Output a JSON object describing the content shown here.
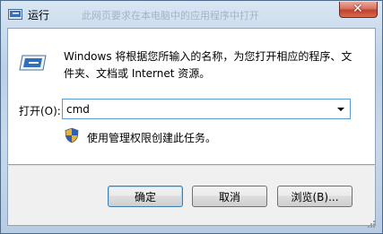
{
  "window": {
    "title": "运行",
    "background_ghost_text": "此网页要求在本电脑中的应用程序中打开",
    "close_glyph": "✕"
  },
  "dialog": {
    "description": "Windows 将根据您所输入的名称，为您打开相应的程序、文件夹、文档或 Internet 资源。",
    "open_label": "打开(O):",
    "input_value": "cmd",
    "admin_note": "使用管理权限创建此任务。"
  },
  "buttons": {
    "ok": "确定",
    "cancel": "取消",
    "browse": "浏览(B)..."
  },
  "icons": {
    "app": "run-icon",
    "main": "run-dialog-icon",
    "admin": "uac-shield-icon",
    "dropdown": "chevron-down-icon"
  },
  "colors": {
    "close_button": "#c2422c",
    "focus_border": "#5b9bd5"
  }
}
